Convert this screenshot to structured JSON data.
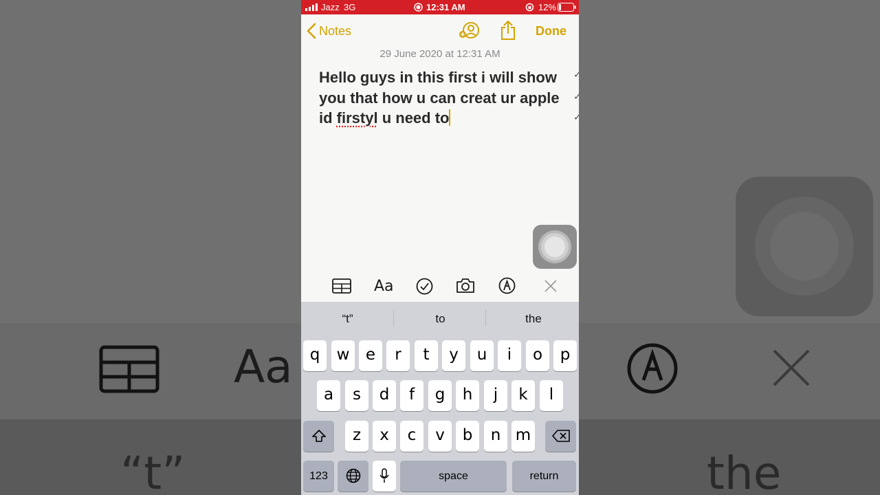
{
  "status_bar": {
    "carrier": "Jazz",
    "network": "3G",
    "time": "12:31 AM",
    "battery": "12%"
  },
  "nav": {
    "back_label": "Notes",
    "done_label": "Done"
  },
  "note": {
    "date": "29 June 2020 at 12:31 AM",
    "text_before": "Hello guys in this first i will show you that how u can creat ur apple id ",
    "misspelled": "firstyl",
    "text_after": " u need to"
  },
  "format_toolbar": {
    "text_style_label": "Aa"
  },
  "suggestions": [
    "“t”",
    "to",
    "the"
  ],
  "keyboard": {
    "row1": [
      "q",
      "w",
      "e",
      "r",
      "t",
      "y",
      "u",
      "i",
      "o",
      "p"
    ],
    "row2": [
      "a",
      "s",
      "d",
      "f",
      "g",
      "h",
      "j",
      "k",
      "l"
    ],
    "row3": [
      "z",
      "x",
      "c",
      "v",
      "b",
      "n",
      "m"
    ],
    "numbers_label": "123",
    "space_label": "space",
    "return_label": "return"
  },
  "background": {
    "text_style_label": "Aa",
    "suggestion_left": "“t”",
    "suggestion_right": "the"
  },
  "colors": {
    "accent": "#d4a300",
    "status_bar": "#d51f26",
    "keyboard_bg": "#d1d3d9"
  }
}
